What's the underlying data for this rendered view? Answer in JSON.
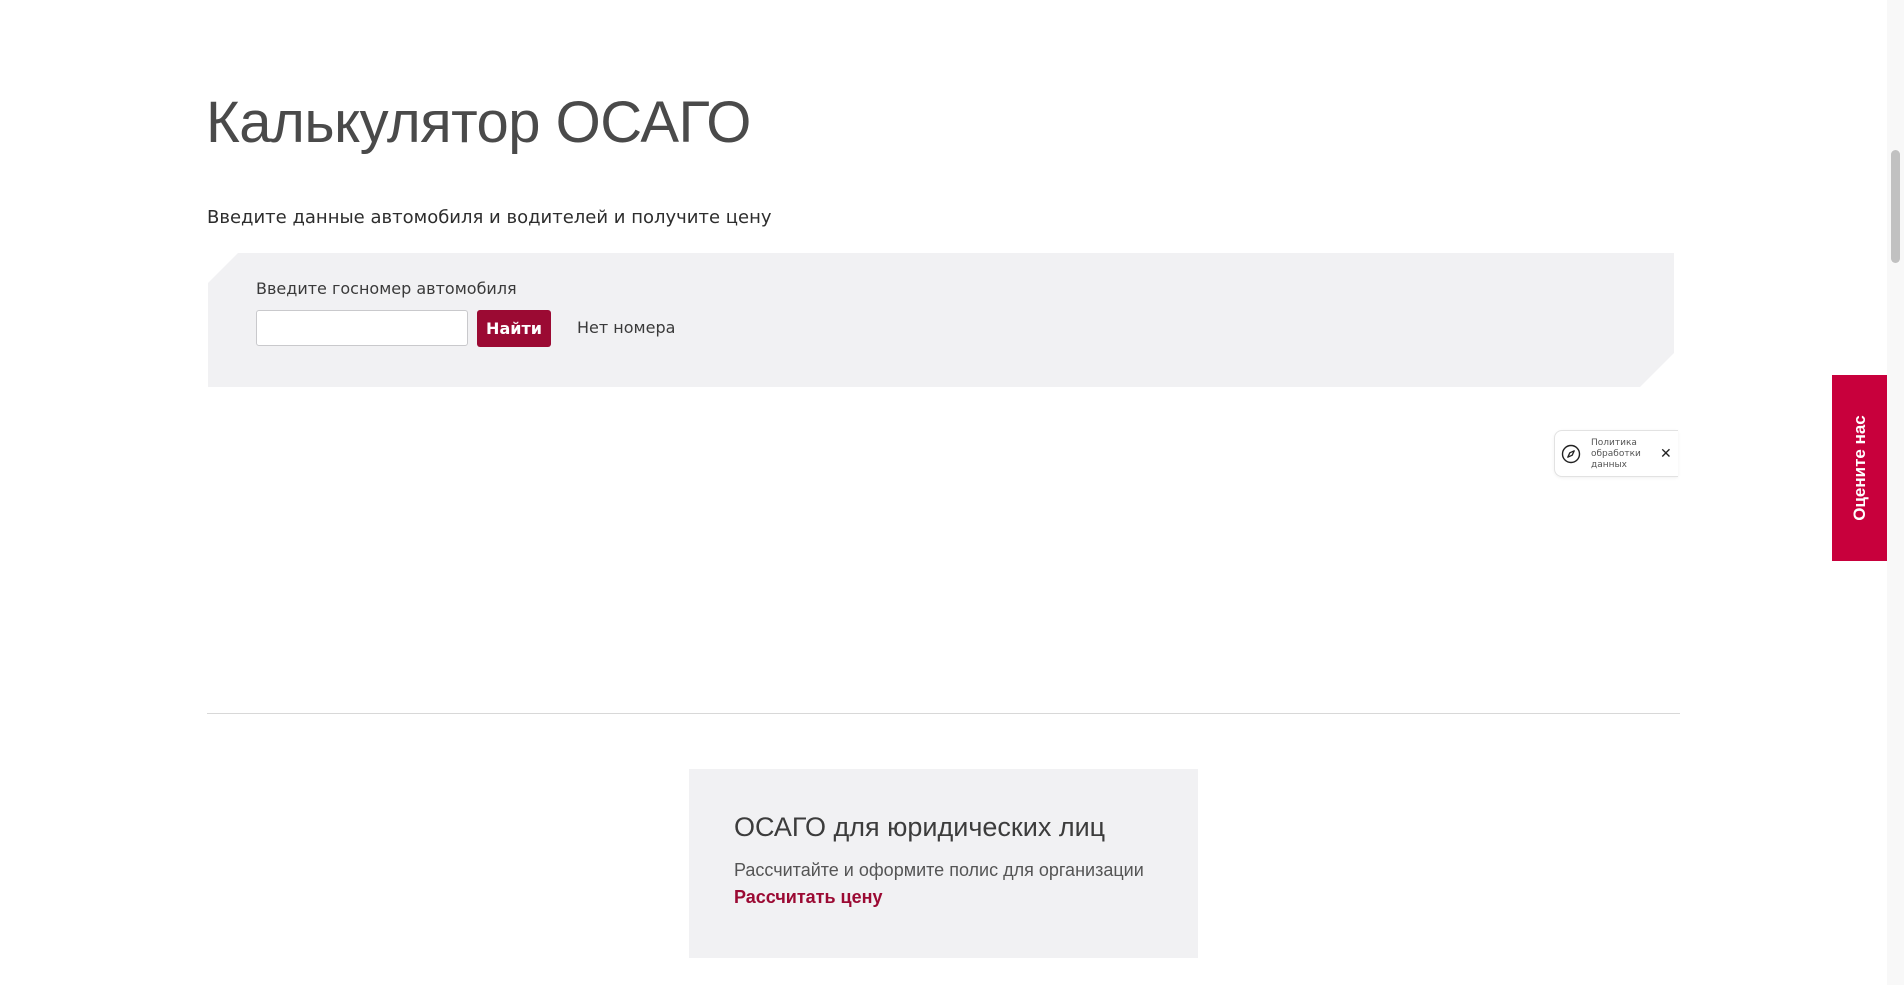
{
  "main": {
    "title": "Калькулятор ОСАГО",
    "subtitle": "Введите данные автомобиля и водителей и получите цену"
  },
  "search": {
    "label": "Введите госномер автомобиля",
    "input_value": "",
    "input_placeholder": "",
    "find_button": "Найти",
    "no_number_link": "Нет номера"
  },
  "privacy_widget": {
    "text": "Политика обработки данных",
    "icon": "compass-icon",
    "close": "✕"
  },
  "corporate": {
    "title": "ОСАГО для юридических лиц",
    "description": "Рассчитайте и оформите полис для организации",
    "link": "Рассчитать цену"
  },
  "feedback_tab": {
    "label": "Оцените нас"
  },
  "colors": {
    "accent": "#9b0a33",
    "feedback": "#c8003c",
    "panel": "#f1f1f3"
  }
}
